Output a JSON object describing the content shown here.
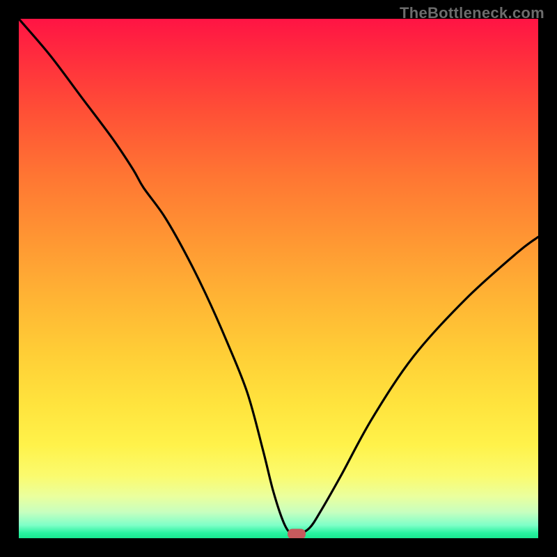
{
  "watermark": "TheBottleneck.com",
  "colors": {
    "frame": "#000000",
    "curve": "#000000",
    "marker": "#c65a5d",
    "gradient_top": "#ff1444",
    "gradient_bottom": "#19e890"
  },
  "chart_data": {
    "type": "line",
    "title": "",
    "xlabel": "",
    "ylabel": "",
    "xlim": [
      0,
      100
    ],
    "ylim": [
      0,
      100
    ],
    "x": [
      0,
      6,
      12,
      18,
      22,
      24,
      28,
      32,
      36,
      40,
      44,
      47,
      49,
      51,
      52.5,
      54,
      56,
      58,
      62,
      68,
      76,
      86,
      96,
      100
    ],
    "values": [
      100,
      93,
      85,
      77,
      71,
      67.5,
      62,
      55,
      47,
      38,
      28,
      17,
      9,
      3,
      0.8,
      0.8,
      2,
      5,
      12,
      23,
      35,
      46,
      55,
      58
    ],
    "marker": {
      "x": 53.5,
      "y": 0.8
    },
    "annotations": [
      {
        "text": "TheBottleneck.com",
        "position": "top-right"
      }
    ]
  }
}
